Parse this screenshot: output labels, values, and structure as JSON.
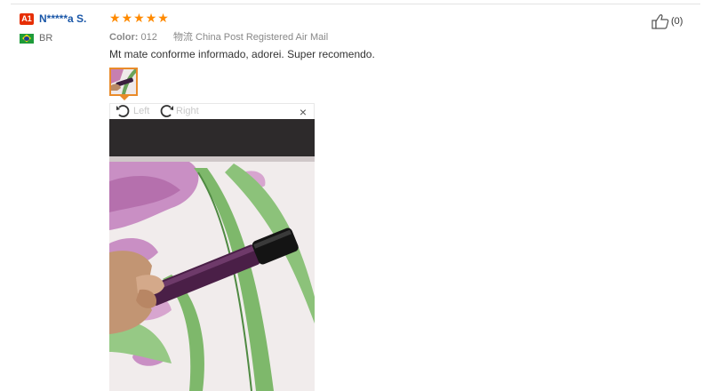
{
  "reviewer": {
    "level_badge": "A1",
    "name": "N*****a S.",
    "country_code": "BR"
  },
  "review": {
    "rating": 5,
    "stars": [
      "★",
      "★",
      "★",
      "★",
      "★"
    ],
    "color_label": "Color:",
    "color_value": "012",
    "shipping_label": "物流",
    "shipping_value": "China Post Registered Air Mail",
    "text": "Mt mate conforme informado, adorei. Super recomendo."
  },
  "viewer": {
    "rotate_left_label": "Left",
    "rotate_right_label": "Right",
    "close_glyph": "×",
    "icons": [
      "rotate-left-icon",
      "rotate-right-icon",
      "close-icon"
    ]
  },
  "helpful": {
    "count": "(0)",
    "icon": "thumbs-up-icon"
  },
  "colors": {
    "star": "#ff8a00",
    "username": "#1a57a8",
    "badge": "#e62e04",
    "thumbnail_border": "#e98b2a"
  }
}
